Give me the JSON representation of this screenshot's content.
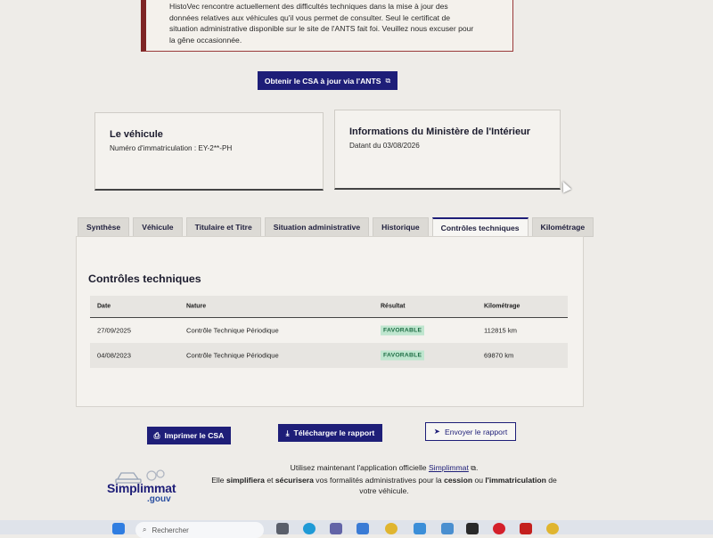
{
  "alert": {
    "line1": "HistoVec rencontre actuellement des difficultés techniques dans la mise à jour des",
    "line2": "données relatives aux véhicules qu'il vous permet de consulter. Seul le certificat de",
    "line3": "situation administrative disponible sur le site de l'ANTS fait foi. Veuillez nous excuser pour",
    "line4": "la gêne occasionnée."
  },
  "csa_button": {
    "label": "Obtenir le CSA à jour via l'ANTS",
    "icon": "external-link-icon"
  },
  "vehicle_card": {
    "title": "Le véhicule",
    "plate_label": "Numéro d'immatriculation : EY-2**-PH"
  },
  "ministry_card": {
    "title": "Informations du Ministère de l'Intérieur",
    "date_label": "Datant du 03/08/2026"
  },
  "tabs": [
    {
      "label": "Synthèse"
    },
    {
      "label": "Véhicule"
    },
    {
      "label": "Titulaire et Titre"
    },
    {
      "label": "Situation administrative"
    },
    {
      "label": "Historique"
    },
    {
      "label": "Contrôles techniques",
      "active": true
    },
    {
      "label": "Kilométrage"
    }
  ],
  "panel": {
    "title": "Contrôles techniques",
    "headers": [
      "Date",
      "Nature",
      "Résultat",
      "Kilométrage"
    ],
    "rows": [
      {
        "date": "27/09/2025",
        "nature": "Contrôle Technique Périodique",
        "result": "FAVORABLE",
        "km": "112815 km"
      },
      {
        "date": "04/08/2023",
        "nature": "Contrôle Technique Périodique",
        "result": "FAVORABLE",
        "km": "69870 km"
      }
    ]
  },
  "actions": {
    "print": "Imprimer le CSA",
    "download": "Télécharger le rapport",
    "send": "Envoyer le rapport"
  },
  "promo": {
    "lead": "Utilisez maintenant l'application officielle",
    "app_link": "Simplimmat",
    "line2_a": "Elle",
    "simplifiera": "simplifiera",
    "et": "et",
    "securisera": "sécurisera",
    "line2_b": "vos formalités administratives pour la",
    "cession": "cession",
    "ou": "ou",
    "immatriculation": "l'immatriculation",
    "de": "de",
    "line3": "votre véhicule."
  },
  "logo": {
    "word": "Simplimmat",
    "gouv": ".gouv"
  },
  "taskbar": {
    "search_placeholder": "Rechercher"
  },
  "colors": {
    "primary": "#1e1e78",
    "alert_border": "#7e2525",
    "badge_bg": "#bfe6cf",
    "badge_text": "#1f6e45"
  }
}
